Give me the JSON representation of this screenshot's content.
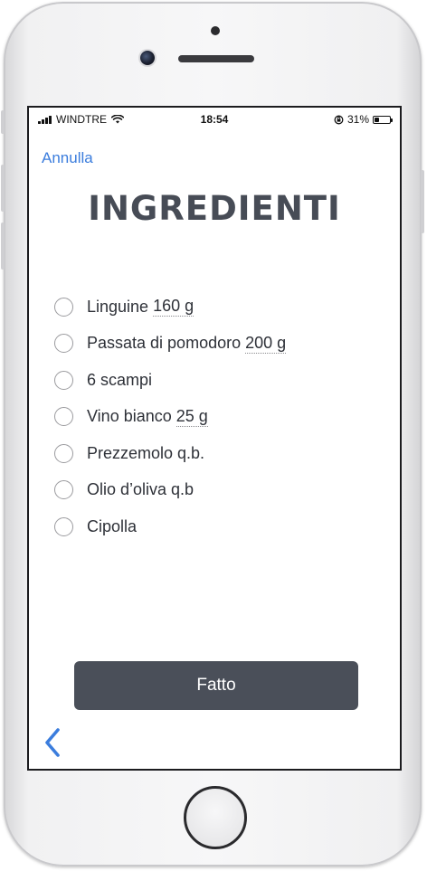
{
  "status_bar": {
    "carrier": "WINDTRE",
    "time": "18:54",
    "battery": "31%",
    "battery_level": 0.31,
    "icons": [
      "signal-icon",
      "wifi-icon",
      "rotation-lock-icon",
      "battery-icon"
    ]
  },
  "nav": {
    "cancel_label": "Annulla",
    "back_icon": "chevron-left-icon"
  },
  "page": {
    "title": "INGREDIENTI"
  },
  "ingredients": [
    {
      "name": "Linguine",
      "qty": "160 g",
      "checked": false
    },
    {
      "name": "Passata di pomodoro",
      "qty": "200 g",
      "checked": false
    },
    {
      "name": "6 scampi",
      "qty": "",
      "checked": false
    },
    {
      "name": "Vino bianco",
      "qty": "25 g",
      "checked": false
    },
    {
      "name": "Prezzemolo q.b.",
      "qty": "",
      "checked": false
    },
    {
      "name": "Olio d’oliva q.b",
      "qty": "",
      "checked": false
    },
    {
      "name": "Cipolla",
      "qty": "",
      "checked": false
    }
  ],
  "footer": {
    "done_label": "Fatto"
  },
  "colors": {
    "accent": "#3b7ddd",
    "title": "#474c56",
    "button_bg": "#4a4f59",
    "text": "#2e3138"
  }
}
